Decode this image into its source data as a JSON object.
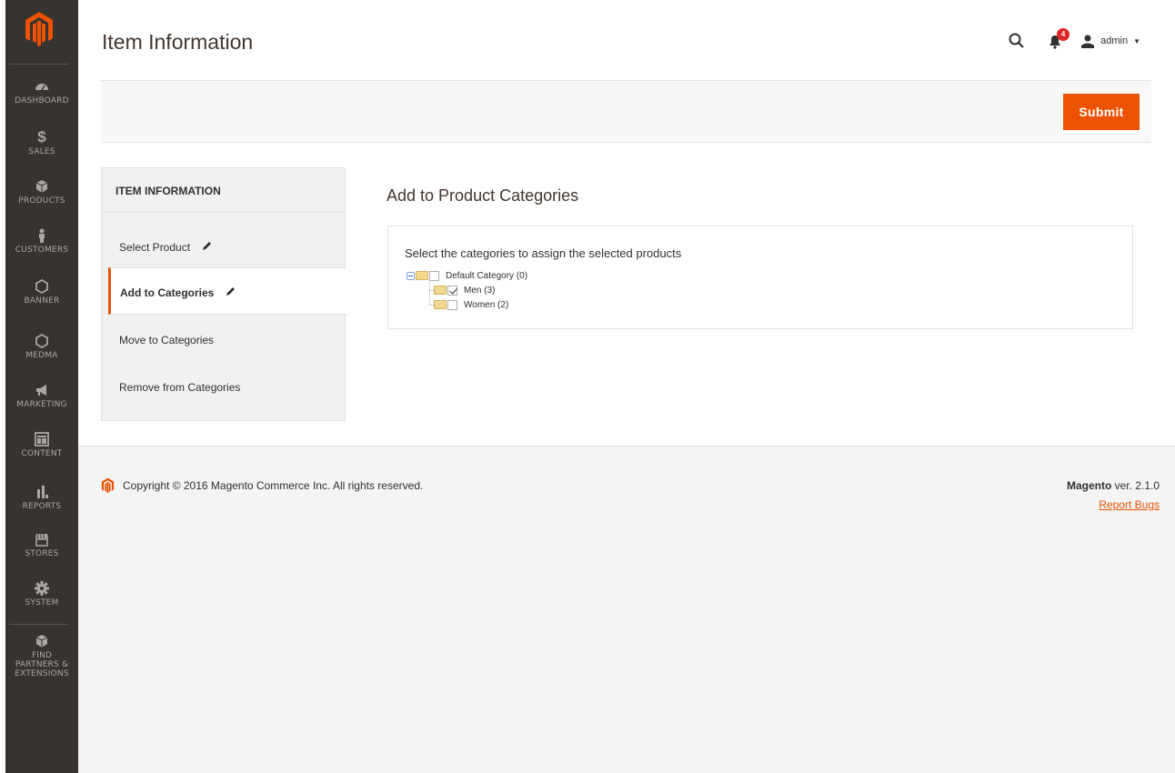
{
  "sidebar": {
    "items": [
      {
        "label": "DASHBOARD",
        "icon": "dashboard-icon"
      },
      {
        "label": "SALES",
        "icon": "dollar-icon"
      },
      {
        "label": "PRODUCTS",
        "icon": "box-icon"
      },
      {
        "label": "CUSTOMERS",
        "icon": "person-icon"
      },
      {
        "label": "BANNER",
        "icon": "hexagon-icon"
      },
      {
        "label": "MEDMA",
        "icon": "hexagon-icon"
      },
      {
        "label": "MARKETING",
        "icon": "megaphone-icon"
      },
      {
        "label": "CONTENT",
        "icon": "layout-icon"
      },
      {
        "label": "REPORTS",
        "icon": "bar-chart-icon"
      },
      {
        "label": "STORES",
        "icon": "storefront-icon"
      },
      {
        "label": "SYSTEM",
        "icon": "gear-icon"
      },
      {
        "label": "FIND\nPARTNERS &\nEXTENSIONS",
        "label_lines": [
          "FIND",
          "PARTNERS &",
          "EXTENSIONS"
        ],
        "icon": "cube-icon"
      }
    ]
  },
  "header": {
    "title": "Item Information",
    "notifications_count": "4",
    "user_name": "admin"
  },
  "action_bar": {
    "submit_label": "Submit"
  },
  "tabs": {
    "title": "ITEM INFORMATION",
    "items": [
      {
        "label": "Select Product",
        "edited": true,
        "active": false
      },
      {
        "label": "Add to Categories",
        "edited": true,
        "active": true
      },
      {
        "label": "Move to Categories",
        "edited": false,
        "active": false
      },
      {
        "label": "Remove from Categories",
        "edited": false,
        "active": false
      }
    ]
  },
  "main": {
    "section_title": "Add to Product Categories",
    "fieldset_label": "Select the categories to assign the selected products",
    "tree": {
      "root": {
        "label": "Default Category (0)",
        "checked": false
      },
      "children": [
        {
          "label": "Men (3)",
          "checked": true
        },
        {
          "label": "Women (2)",
          "checked": false
        }
      ]
    }
  },
  "footer": {
    "copyright": "Copyright © 2016 Magento Commerce Inc. All rights reserved.",
    "brand": "Magento",
    "version": " ver. 2.1.0",
    "report_bugs": "Report Bugs"
  },
  "colors": {
    "accent": "#eb5202",
    "sidebar_bg": "#373330",
    "badge": "#e22626"
  }
}
